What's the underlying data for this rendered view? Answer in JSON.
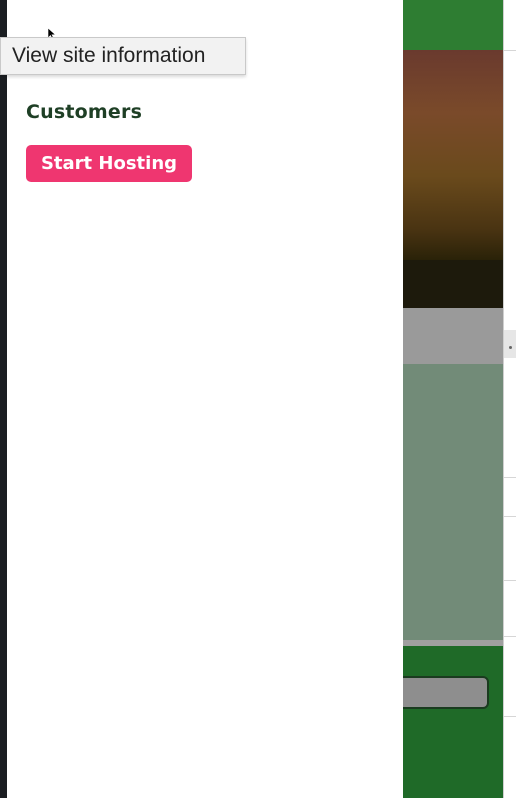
{
  "tooltip": {
    "text": "View site information"
  },
  "drawer": {
    "customers_label": "Customers",
    "start_hosting_label": "Start Hosting"
  },
  "colors": {
    "accent_pink": "#ef3670",
    "dark_green_text": "#1e3f25",
    "brand_green": "#2e7d32"
  },
  "icons": {
    "cursor": "cursor-icon"
  }
}
